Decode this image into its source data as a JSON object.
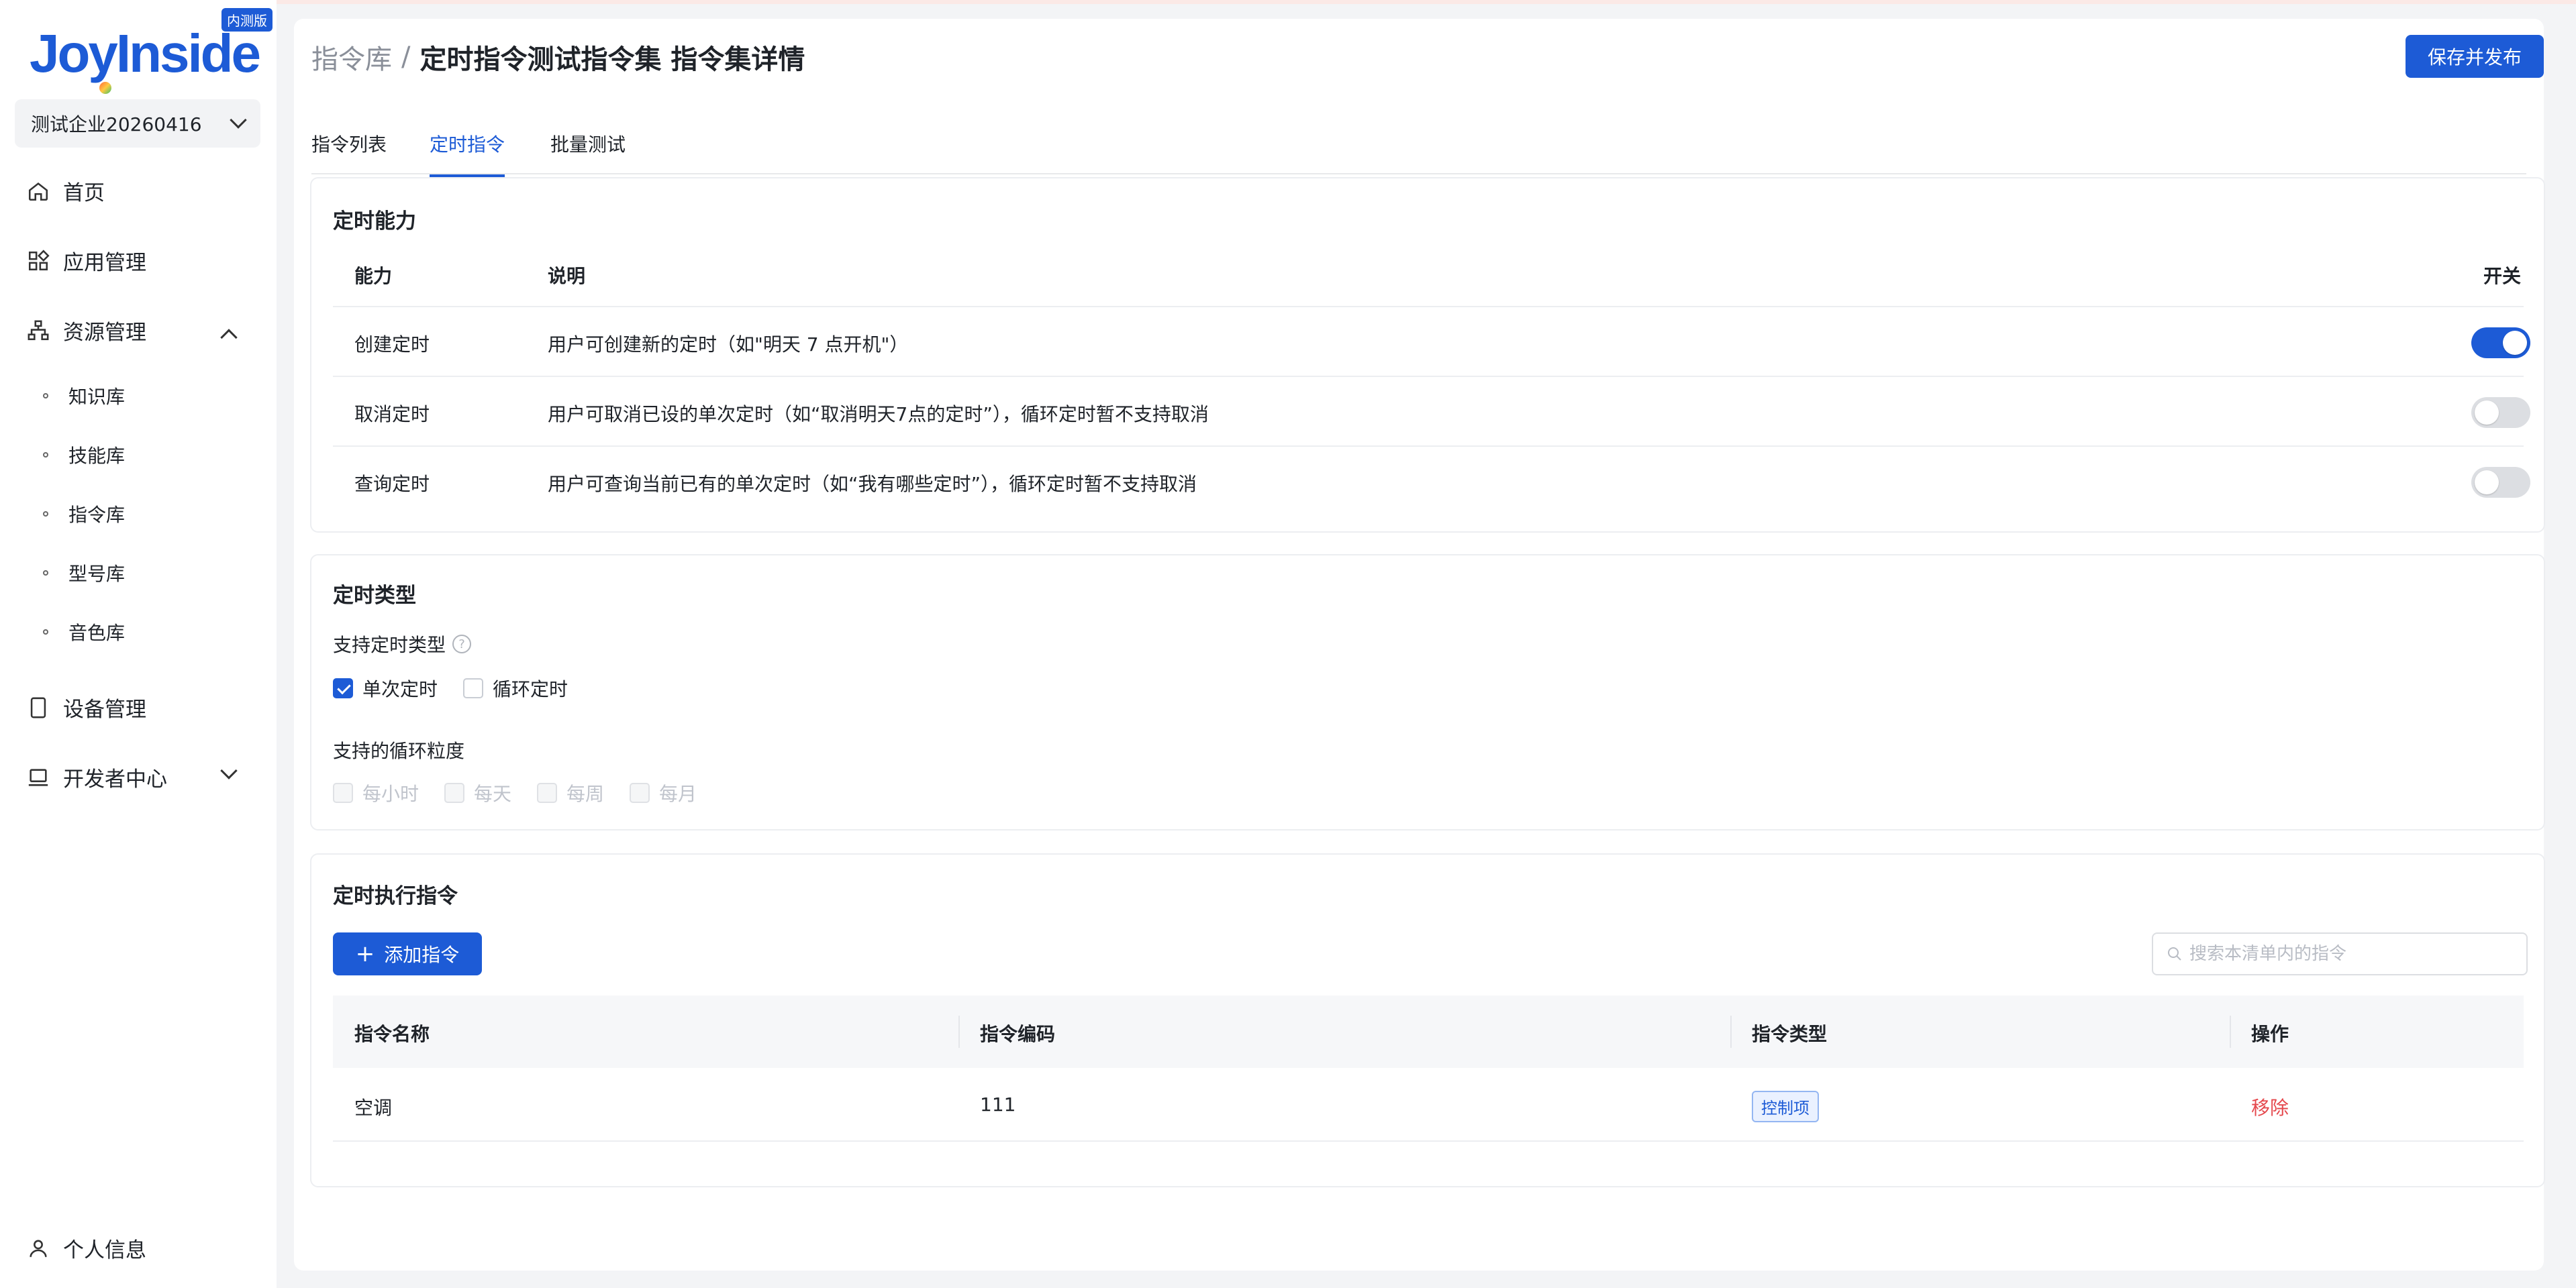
{
  "brand": {
    "name": "JoyInside",
    "badge": "内测版"
  },
  "sidebar": {
    "company": "测试企业20260416",
    "items": [
      {
        "label": "首页",
        "icon": "home-icon"
      },
      {
        "label": "应用管理",
        "icon": "apps-icon"
      },
      {
        "label": "资源管理",
        "icon": "sitemap-icon",
        "expanded": true
      },
      {
        "label": "设备管理",
        "icon": "tablet-icon"
      },
      {
        "label": "开发者中心",
        "icon": "laptop-icon",
        "expanded": false
      }
    ],
    "sub_items": [
      "知识库",
      "技能库",
      "指令库",
      "型号库",
      "音色库"
    ],
    "profile": "个人信息"
  },
  "header": {
    "breadcrumb_root": "指令库",
    "breadcrumb_sep": "/",
    "title": "定时指令测试指令集 指令集详情",
    "save_button": "保存并发布"
  },
  "tabs": [
    {
      "label": "指令列表",
      "active": false
    },
    {
      "label": "定时指令",
      "active": true
    },
    {
      "label": "批量测试",
      "active": false
    }
  ],
  "capabilities": {
    "title": "定时能力",
    "columns": [
      "能力",
      "说明",
      "开关"
    ],
    "rows": [
      {
        "name": "创建定时",
        "desc": "用户可创建新的定时（如\"明天 7 点开机\"）",
        "enabled": true
      },
      {
        "name": "取消定时",
        "desc": "用户可取消已设的单次定时（如“取消明天7点的定时”），循环定时暂不支持取消",
        "enabled": false
      },
      {
        "name": "查询定时",
        "desc": "用户可查询当前已有的单次定时（如“我有哪些定时”），循环定时暂不支持取消",
        "enabled": false
      }
    ]
  },
  "timer_types": {
    "title": "定时类型",
    "supported_label": "支持定时类型",
    "options": [
      {
        "label": "单次定时",
        "checked": true
      },
      {
        "label": "循环定时",
        "checked": false
      }
    ],
    "granularity_label": "支持的循环粒度",
    "granularity": [
      {
        "label": "每小时"
      },
      {
        "label": "每天"
      },
      {
        "label": "每周"
      },
      {
        "label": "每月"
      }
    ]
  },
  "commands": {
    "title": "定时执行指令",
    "add_button": "添加指令",
    "search_placeholder": "搜索本清单内的指令",
    "columns": [
      "指令名称",
      "指令编码",
      "指令类型",
      "操作"
    ],
    "rows": [
      {
        "name": "空调",
        "code": "111",
        "type": "控制项",
        "action": "移除"
      }
    ]
  }
}
